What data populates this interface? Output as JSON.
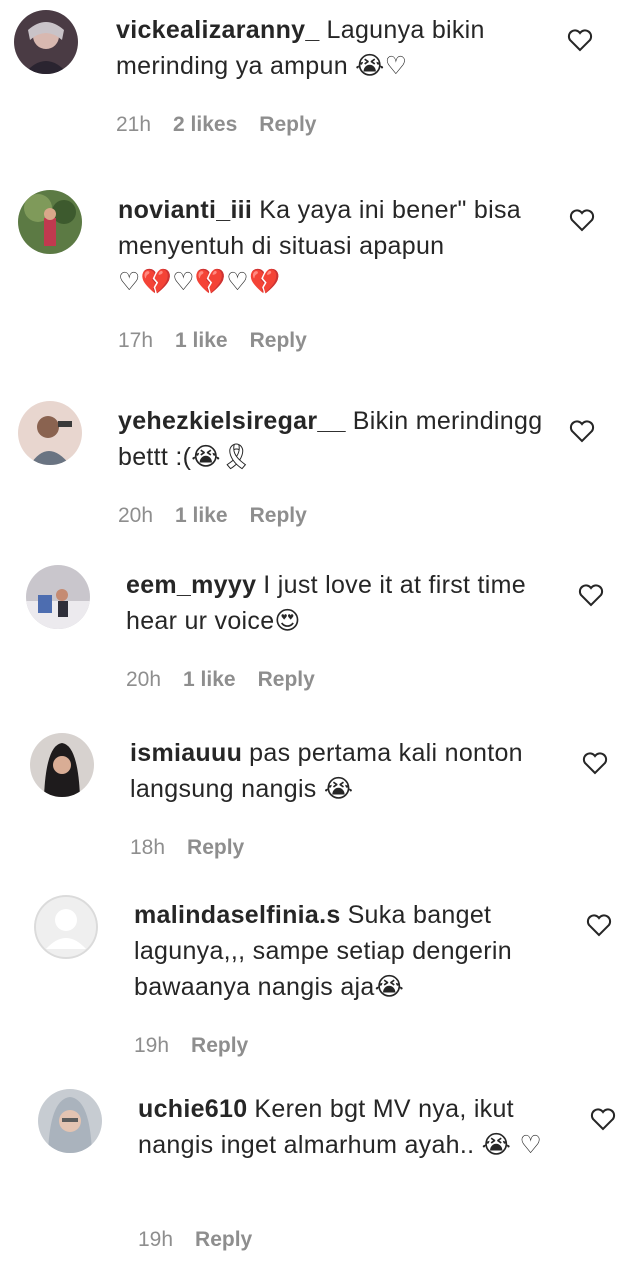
{
  "comments": [
    {
      "username": "vickealizaranny_",
      "text": "Lagunya bikin merinding ya ampun",
      "emoji": "😭♡",
      "time": "21h",
      "likes": "2 likes",
      "reply": "Reply"
    },
    {
      "username": "novianti_iii",
      "text": "Ka yaya ini bener\" bisa menyentuh di situasi apapun",
      "emoji": "♡💔♡💔♡💔",
      "time": "17h",
      "likes": "1 like",
      "reply": "Reply"
    },
    {
      "username": "yehezkielsiregar__",
      "text": "Bikin merindingg bettt :(",
      "emoji": "😭🎗",
      "time": "20h",
      "likes": "1 like",
      "reply": "Reply"
    },
    {
      "username": "eem_myyy",
      "text": "I just love it at first time hear ur voice",
      "emoji": "😍",
      "time": "20h",
      "likes": "1 like",
      "reply": "Reply"
    },
    {
      "username": "ismiauuu",
      "text": "pas pertama kali nonton langsung nangis",
      "emoji": "😭",
      "time": "18h",
      "likes": "",
      "reply": "Reply"
    },
    {
      "username": "malindaselfinia.s",
      "text": "Suka banget lagunya,,, sampe setiap dengerin bawaanya nangis aja",
      "emoji": "😭",
      "time": "19h",
      "likes": "",
      "reply": "Reply"
    },
    {
      "username": "uchie610",
      "text": "Keren bgt MV nya, ikut nangis inget almarhum ayah..",
      "emoji": "😭 ♡",
      "time": "19h",
      "likes": "",
      "reply": "Reply"
    }
  ],
  "colors": {
    "text": "#262626",
    "meta": "#8e8e8e",
    "icon": "#262626"
  }
}
